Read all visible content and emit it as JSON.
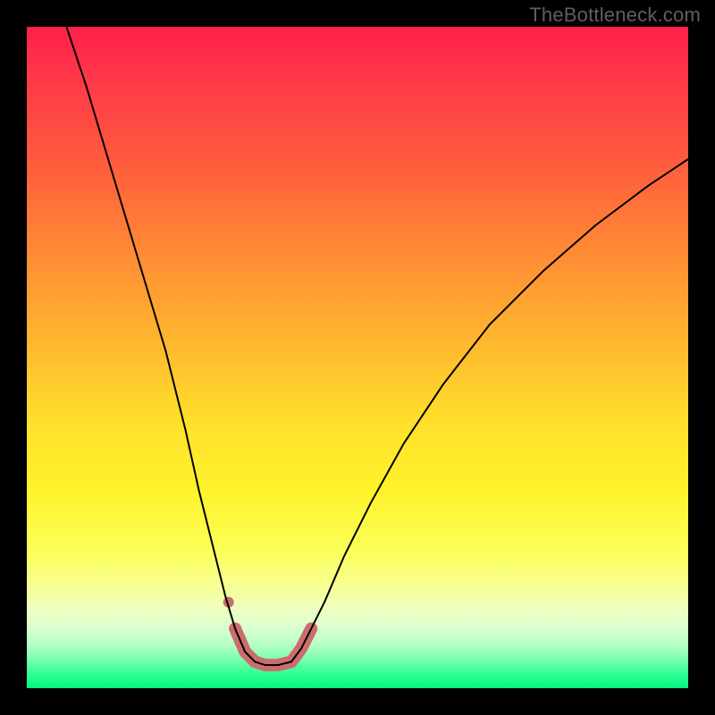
{
  "watermark": "TheBottleneck.com",
  "chart_data": {
    "type": "line",
    "title": "",
    "xlabel": "",
    "ylabel": "",
    "xlim": [
      0,
      100
    ],
    "ylim": [
      0,
      100
    ],
    "grid": false,
    "series": [
      {
        "name": "bottleneck-curve",
        "color": "#000000",
        "points": [
          [
            6,
            100
          ],
          [
            9,
            91
          ],
          [
            12,
            81
          ],
          [
            15,
            71
          ],
          [
            18,
            61
          ],
          [
            21,
            51
          ],
          [
            24,
            39
          ],
          [
            26,
            30
          ],
          [
            28,
            22
          ],
          [
            30,
            14
          ],
          [
            31.5,
            9
          ],
          [
            33,
            5.5
          ],
          [
            34.5,
            4
          ],
          [
            36,
            3.5
          ],
          [
            38,
            3.5
          ],
          [
            40,
            4
          ],
          [
            41.5,
            6
          ],
          [
            43,
            9
          ],
          [
            45,
            13
          ],
          [
            48,
            20
          ],
          [
            52,
            28
          ],
          [
            57,
            37
          ],
          [
            63,
            46
          ],
          [
            70,
            55
          ],
          [
            78,
            63
          ],
          [
            86,
            70
          ],
          [
            94,
            76
          ],
          [
            100,
            80
          ]
        ]
      },
      {
        "name": "highlight-base",
        "color": "#cc6d6d",
        "stroke_width": 14,
        "points": [
          [
            31.5,
            9
          ],
          [
            33,
            5.5
          ],
          [
            34.5,
            4
          ],
          [
            36,
            3.5
          ],
          [
            38,
            3.5
          ],
          [
            40,
            4
          ],
          [
            41.5,
            6
          ],
          [
            43,
            9
          ]
        ]
      },
      {
        "name": "highlight-dot",
        "color": "#cc6d6d",
        "type": "scatter",
        "points": [
          [
            30.5,
            13
          ]
        ]
      }
    ],
    "gradient_colors": {
      "top": "#ff1f4a",
      "upper_mid": "#ffb82f",
      "mid": "#fff22a",
      "lower_mid": "#eeffbf",
      "bottom": "#08f07b"
    }
  }
}
